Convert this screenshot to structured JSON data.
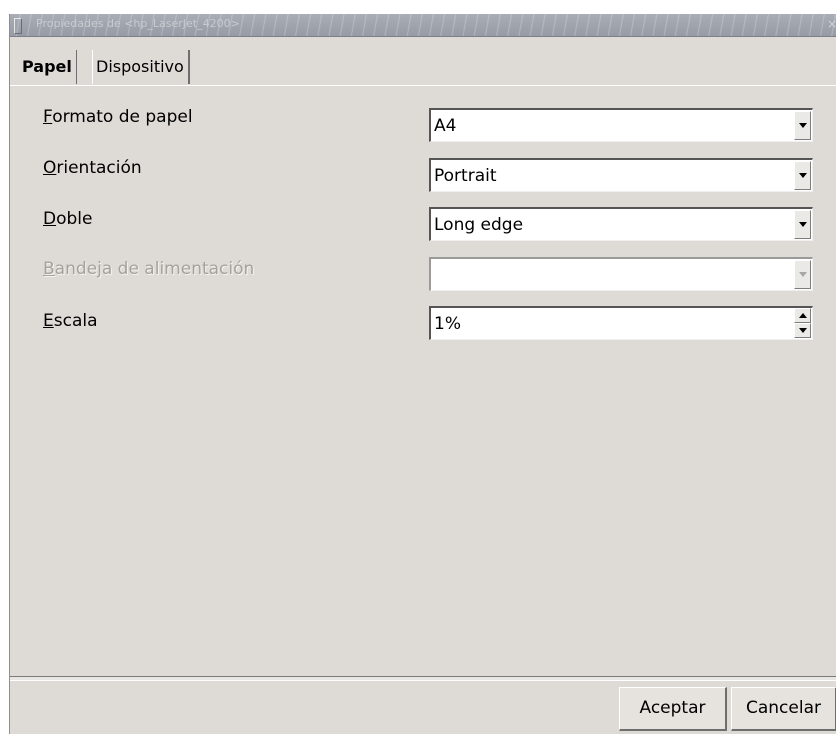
{
  "window": {
    "title": "Propiedades de <hp_LaserJet_4200>",
    "close_glyph": "×"
  },
  "tabs": [
    {
      "label": "Papel",
      "active": true
    },
    {
      "label": "Dispositivo",
      "active": false
    }
  ],
  "form": {
    "paper_format": {
      "mnemonic": "F",
      "label_rest": "ormato de papel",
      "value": "A4"
    },
    "orientation": {
      "mnemonic": "O",
      "label_rest": "rientación",
      "value": "Portrait"
    },
    "duplex": {
      "mnemonic": "D",
      "label_rest": "oble",
      "value": "Long edge"
    },
    "paper_tray": {
      "mnemonic": "B",
      "label_rest": "andeja de alimentación",
      "value": "",
      "disabled": true
    },
    "scale": {
      "mnemonic": "E",
      "label_rest": "scala",
      "value": "1%"
    }
  },
  "buttons": {
    "accept": "Aceptar",
    "cancel": "Cancelar"
  },
  "colors": {
    "dialog_bg": "#dedbd6",
    "titlebar": "#a9adb6",
    "disabled_text": "#a5a29d"
  },
  "icons": {
    "title_menu": "window-menu-icon",
    "combo_arrow": "chevron-down-icon",
    "spin_up": "chevron-up-icon",
    "spin_down": "chevron-down-icon"
  }
}
